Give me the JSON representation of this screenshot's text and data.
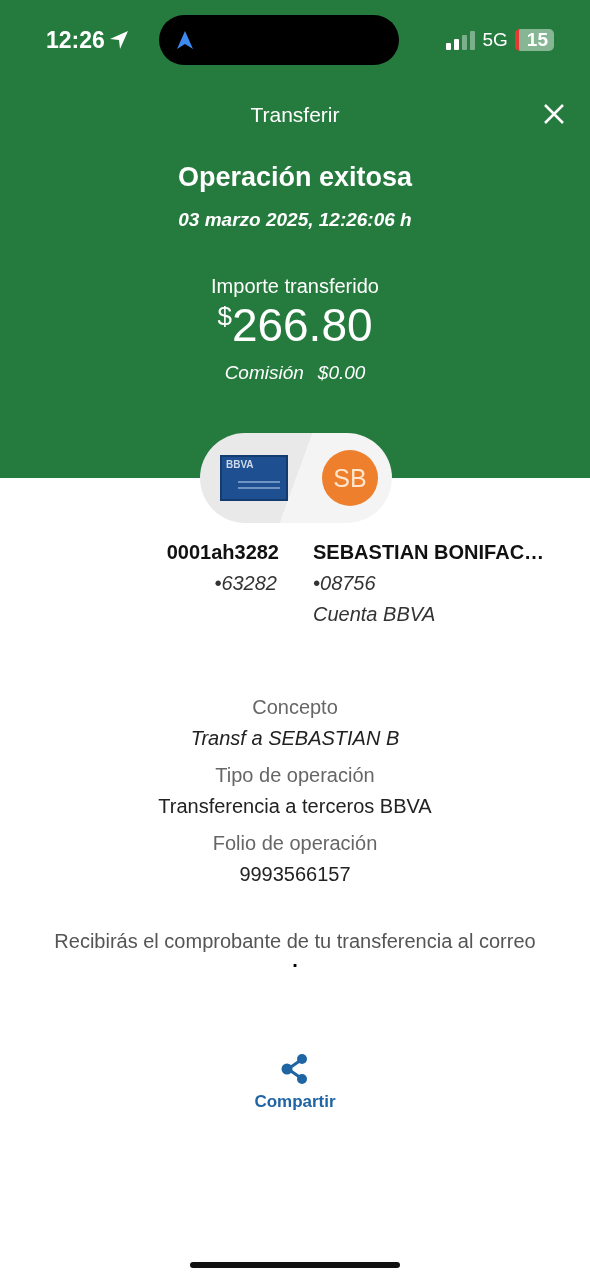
{
  "status_bar": {
    "time": "12:26",
    "network": "5G",
    "battery": "15"
  },
  "header": {
    "title": "Transferir"
  },
  "result": {
    "title": "Operación exitosa",
    "date": "03 marzo 2025, 12:26:06 h",
    "amount_label": "Importe transferido",
    "currency": "$",
    "amount": "266.80",
    "commission_label": "Comisión",
    "commission": "$0.00"
  },
  "transfer": {
    "card_label": "BBVA",
    "avatar_initials": "SB",
    "from": {
      "name": "0001ah3282",
      "account": "•63282"
    },
    "to": {
      "name": "SEBASTIAN BONIFAC…",
      "account": "•08756",
      "bank": "Cuenta BBVA"
    }
  },
  "details": [
    {
      "label": "Concepto",
      "value": "Transf a SEBASTIAN B",
      "italic": true
    },
    {
      "label": "Tipo de operación",
      "value": "Transferencia a terceros BBVA",
      "italic": false
    },
    {
      "label": "Folio de operación",
      "value": "9993566157",
      "italic": false
    }
  ],
  "note": {
    "text": "Recibirás el comprobante de tu transferencia al correo",
    "email": "."
  },
  "share": {
    "label": "Compartir"
  }
}
